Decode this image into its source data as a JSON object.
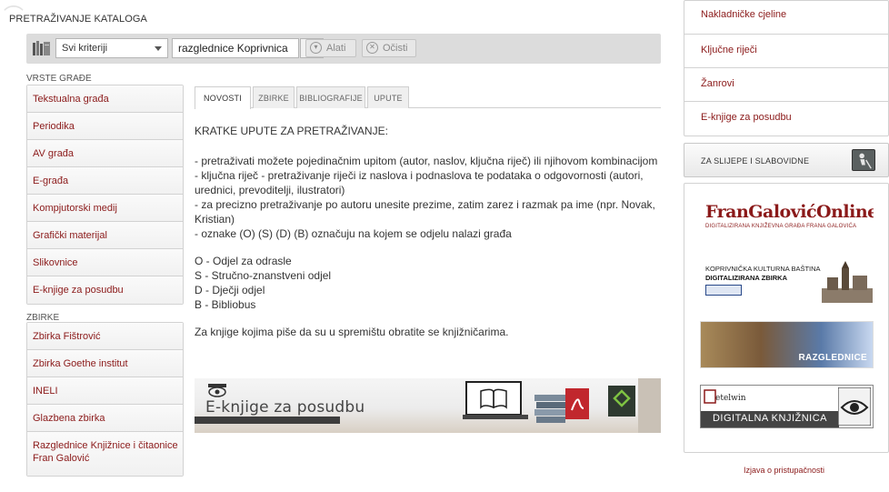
{
  "header": {
    "title": "PRETRAŽIVANJE KATALOGA"
  },
  "search": {
    "criteria_value": "Svi kriteriji",
    "query_value": "razglednice Koprivnica",
    "tools_label": "Alati",
    "clear_label": "Očisti"
  },
  "sidebar": {
    "section1_label": "VRSTE GRAĐE",
    "types": [
      {
        "label": "Tekstualna građa"
      },
      {
        "label": "Periodika"
      },
      {
        "label": "AV građa"
      },
      {
        "label": "E-građa"
      },
      {
        "label": "Kompjutorski medij"
      },
      {
        "label": "Grafički materijal"
      },
      {
        "label": "Slikovnice"
      },
      {
        "label": "E-knjige za posudbu"
      }
    ],
    "section2_label": "ZBIRKE",
    "collections": [
      {
        "label": "Zbirka Fištrović"
      },
      {
        "label": "Zbirka Goethe institut"
      },
      {
        "label": "INELI"
      },
      {
        "label": "Glazbena zbirka"
      },
      {
        "label": "Razglednice Knjižnice i čitaonice Fran Galović"
      }
    ]
  },
  "tabs": [
    {
      "label": "NOVOSTI"
    },
    {
      "label": "ZBIRKE"
    },
    {
      "label": "BIBLIOGRAFIJE"
    },
    {
      "label": "UPUTE"
    }
  ],
  "content": {
    "heading": "KRATKE UPUTE ZA PRETRAŽIVANJE:",
    "instructions": [
      " - pretraživati možete pojedinačnim upitom (autor, naslov, ključna riječ) ili njihovom kombinacijom",
      "- ključna riječ - pretraživanje riječi iz naslova i podnaslova te podataka o odgovornosti (autori, urednici, prevoditelji, ilustratori)",
      " - za precizno pretraživanje po autoru unesite prezime, zatim zarez i razmak pa ime (npr. Novak, Kristian)",
      "- oznake (O) (S) (D) (B) označuju na kojem se odjelu nalazi građa"
    ],
    "departments": [
      "O - Odjel za odrasle",
      "S - Stručno-znanstveni odjel",
      "D - Dječji odjel",
      "B - Bibliobus"
    ],
    "note": "Za knjige kojima piše da su u spremištu obratite se knjižničarima.",
    "banner_title": "E-knjige za posudbu"
  },
  "right_links": [
    {
      "label": "Nakladničke cjeline"
    },
    {
      "label": "Ključne riječi"
    },
    {
      "label": "Žanrovi"
    },
    {
      "label": "E-knjige za posudbu"
    }
  ],
  "accessibility_label": "ZA SLIJEPE I SLABOVIDNE",
  "partners": {
    "fran_title": "FranGalovićOnline",
    "fran_sub": "DIGITALIZIRANA KNJIŽEVNA GRAĐA FRANA GALOVIĆA",
    "kkb_line1": "KOPRIVNIČKA KULTURNA BAŠTINA",
    "kkb_line2": "DIGITALIZIRANA ZBIRKA",
    "razglednice_label": "RAZGLEDNICE",
    "digital_logo": "etelwin",
    "digital_label": "DIGITALNA KNJIŽNICA"
  },
  "footer": {
    "accessibility_statement": "Izjava o pristupačnosti"
  },
  "colors": {
    "link": "#8b1a1a",
    "toolbar": "#dcdcdc"
  }
}
